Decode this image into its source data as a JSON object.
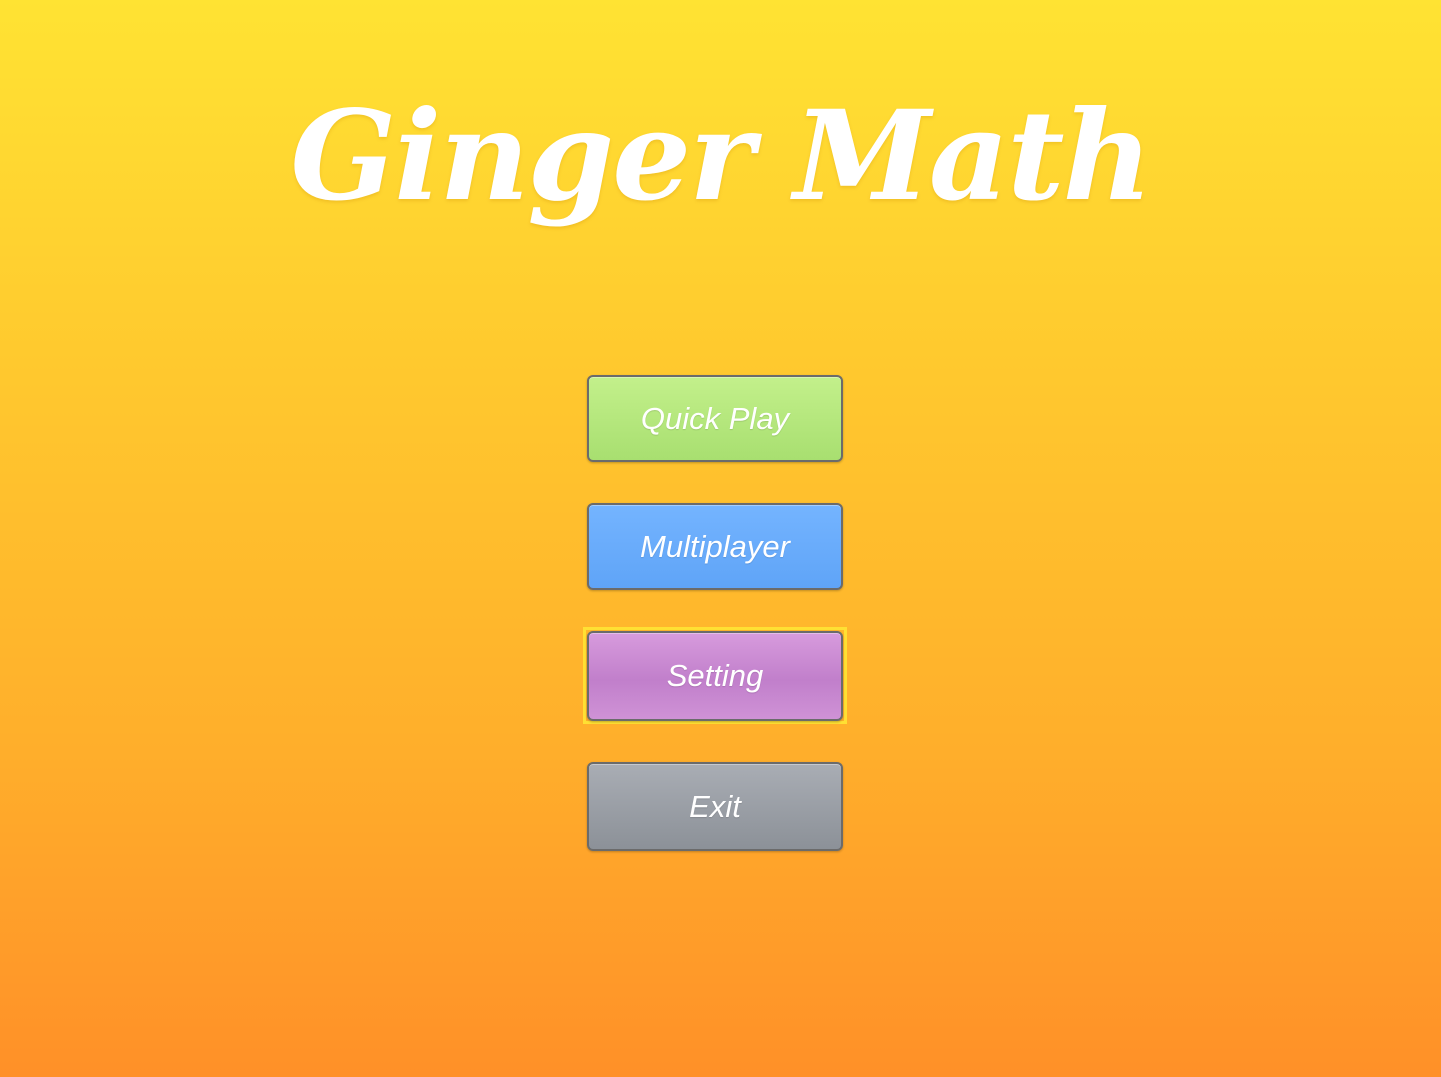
{
  "title": "Ginger Math",
  "menu": {
    "quick_play_label": "Quick Play",
    "multiplayer_label": "Multiplayer",
    "setting_label": "Setting",
    "exit_label": "Exit"
  },
  "colors": {
    "background_top": "#ffe333",
    "background_bottom": "#ff9028",
    "quick_play": "#b6e87d",
    "multiplayer": "#69acfb",
    "setting": "#cc8dd4",
    "exit": "#9a9ea5",
    "focus_outline": "#ffe033"
  },
  "focused_item": "Setting"
}
